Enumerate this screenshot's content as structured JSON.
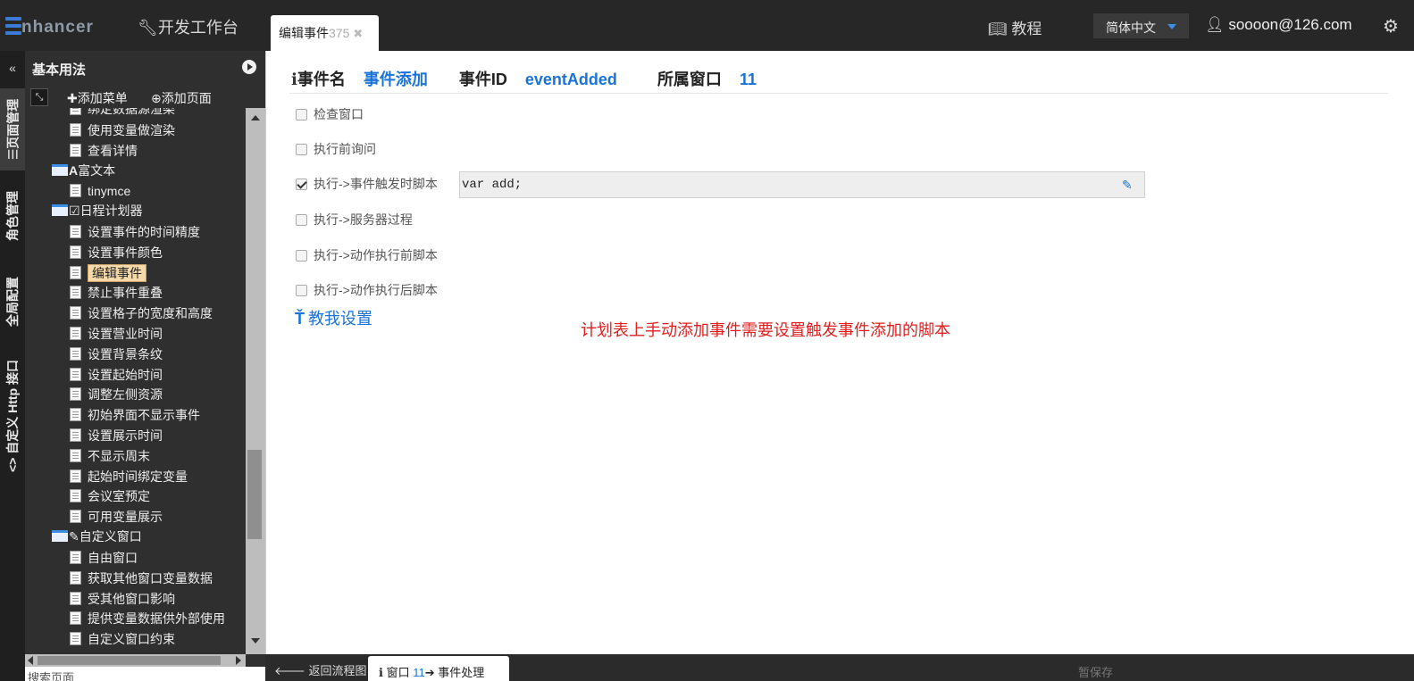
{
  "topbar": {
    "logo_rest": "nhancer",
    "devbench": "开发工作台",
    "doc_tab": {
      "label": "编辑事件",
      "num": "375"
    },
    "tutorial": "教程",
    "language": "简体中文",
    "user": "soooon@126.com"
  },
  "vnav": {
    "tabs": [
      {
        "label": "☰页面管理"
      },
      {
        "label": "角色管理"
      },
      {
        "label": "全局配置"
      },
      {
        "label": "<> 自定义 Http 接口"
      }
    ]
  },
  "tree": {
    "title": "基本用法",
    "add_menu": "添加菜单",
    "add_page": "添加页面",
    "items": [
      {
        "label": "绑定数据源渲染"
      },
      {
        "label": "使用变量做渲染"
      },
      {
        "label": "查看详情"
      },
      {
        "label": "富文本"
      },
      {
        "label": "tinymce"
      },
      {
        "label": "日程计划器"
      },
      {
        "label": "设置事件的时间精度"
      },
      {
        "label": "设置事件颜色"
      },
      {
        "label": "编辑事件"
      },
      {
        "label": "禁止事件重叠"
      },
      {
        "label": "设置格子的宽度和高度"
      },
      {
        "label": "设置营业时间"
      },
      {
        "label": "设置背景条纹"
      },
      {
        "label": "设置起始时间"
      },
      {
        "label": "调整左侧资源"
      },
      {
        "label": "初始界面不显示事件"
      },
      {
        "label": "设置展示时间"
      },
      {
        "label": "不显示周末"
      },
      {
        "label": "起始时间绑定变量"
      },
      {
        "label": "会议室预定"
      },
      {
        "label": "可用变量展示"
      },
      {
        "label": "自定义窗口"
      },
      {
        "label": "自由窗口"
      },
      {
        "label": "获取其他窗口变量数据"
      },
      {
        "label": "受其他窗口影响"
      },
      {
        "label": "提供变量数据供外部使用"
      },
      {
        "label": "自定义窗口约束"
      }
    ],
    "search_placeholder": "搜索页面"
  },
  "main": {
    "event_name_label": "事件名",
    "event_name": "事件添加",
    "event_id_label": "事件ID",
    "event_id": "eventAdded",
    "window_label": "所属窗口",
    "window_no": "11",
    "options": [
      {
        "label": "检查窗口",
        "checked": false
      },
      {
        "label": "执行前询问",
        "checked": false
      },
      {
        "label": "执行->事件触发时脚本",
        "checked": true
      },
      {
        "label": "执行->服务器过程",
        "checked": false
      },
      {
        "label": "执行->动作执行前脚本",
        "checked": false
      },
      {
        "label": "执行->动作执行后脚本",
        "checked": false
      }
    ],
    "script_value": "var add;",
    "teach_me": "教我设置",
    "note": "计划表上手动添加事件需要设置触发事件添加的脚本"
  },
  "bottombar": {
    "back": "返回流程图",
    "tab_window": "窗口",
    "tab_num": "11",
    "tab_event": "事件处理",
    "save": "暂保存"
  }
}
